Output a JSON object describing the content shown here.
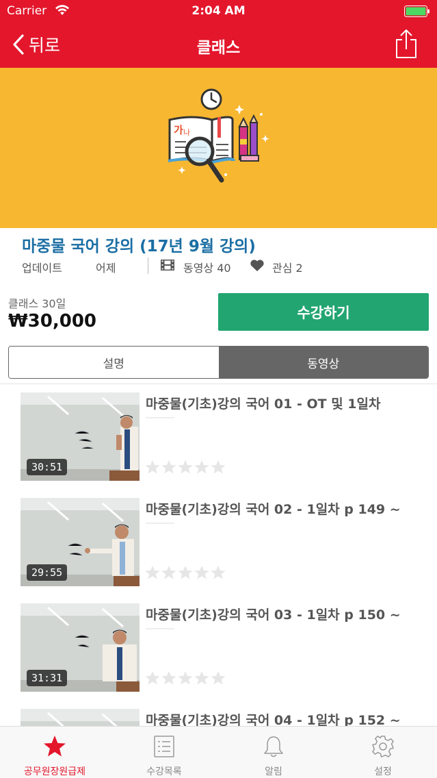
{
  "status": {
    "carrier": "Carrier",
    "time": "2:04 AM"
  },
  "nav": {
    "back_label": "뒤로",
    "title": "클래스"
  },
  "course": {
    "title": "마중물 국어 강의 (17년 9월 강의)",
    "update_label": "업데이트",
    "update_value": "어제",
    "videos_label": "동영상 40",
    "likes_label": "관심 2",
    "period": "클래스 30일",
    "price": "₩30,000",
    "enroll_label": "수강하기"
  },
  "tabs": {
    "description": "설명",
    "videos": "동영상",
    "active": "videos"
  },
  "videos": [
    {
      "title": "마중물(기초)강의 국어 01 - OT 및 1일차",
      "duration": "30:51",
      "rating": 0
    },
    {
      "title": "마중물(기초)강의 국어 02 - 1일차 p 149 ~",
      "duration": "29:55",
      "rating": 0
    },
    {
      "title": "마중물(기초)강의 국어 03 - 1일차 p 150 ~",
      "duration": "31:31",
      "rating": 0
    },
    {
      "title": "마중물(기초)강의 국어 04 - 1일차 p 152 ~",
      "duration": "",
      "rating": 0
    }
  ],
  "tabbar": {
    "items": [
      {
        "label": "공무원장원급제",
        "icon": "star-icon",
        "active": true
      },
      {
        "label": "수강목록",
        "icon": "list-icon",
        "active": false
      },
      {
        "label": "알림",
        "icon": "bell-icon",
        "active": false
      },
      {
        "label": "설정",
        "icon": "gear-icon",
        "active": false
      }
    ]
  },
  "colors": {
    "accent": "#e3162c",
    "banner": "#f7b731",
    "title": "#1b6ea4",
    "enroll": "#23a571"
  }
}
